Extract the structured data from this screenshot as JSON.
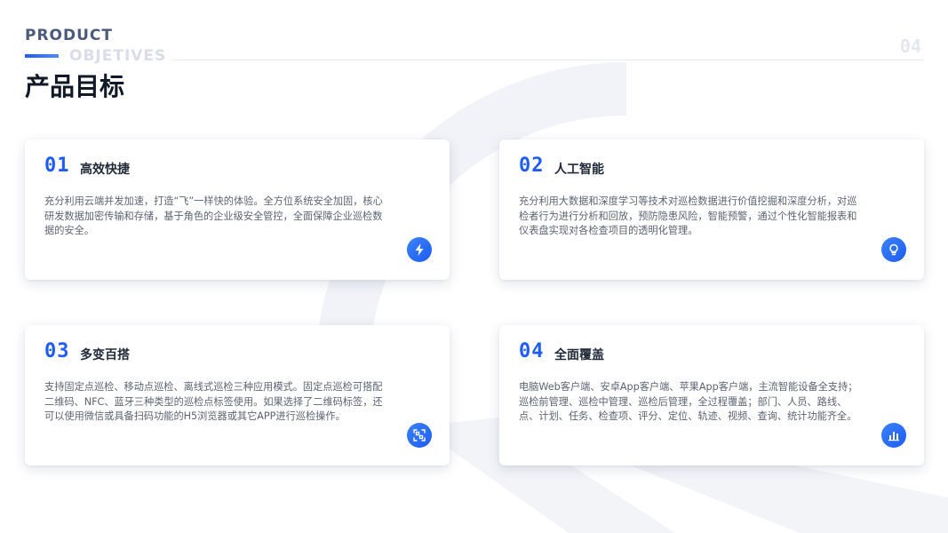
{
  "header": {
    "title_en_1": "PRODUCT",
    "title_en_2": "OBJETIVES",
    "title_cn": "产品目标",
    "page_number": "04"
  },
  "cards": [
    {
      "number": "01",
      "title": "高效快捷",
      "description": "充分利用云端并发加速，打造“飞”一样快的体验。全方位系统安全加固，核心研发数据加密传输和存储，基于角色的企业级安全管控，全面保障企业巡检数据的安全。",
      "icon": "lightning-icon"
    },
    {
      "number": "02",
      "title": "人工智能",
      "description": "充分利用大数据和深度学习等技术对巡检数据进行价值挖掘和深度分析，对巡检者行为进行分析和回放，预防隐患风险，智能预警，通过个性化智能报表和仪表盘实现对各检查项目的透明化管理。",
      "icon": "lightbulb-icon"
    },
    {
      "number": "03",
      "title": "多变百搭",
      "description": "支持固定点巡检、移动点巡检、离线式巡检三种应用模式。固定点巡检可搭配二维码、NFC、蓝牙三种类型的巡检点标签使用。如果选择了二维码标签，还可以使用微信或具备扫码功能的H5浏览器或其它APP进行巡检操作。",
      "icon": "scan-icon"
    },
    {
      "number": "04",
      "title": "全面覆盖",
      "description": "电脑Web客户端、安卓App客户端、苹果App客户端，主流智能设备全支持；巡检前管理、巡检中管理、巡检后管理，全过程覆盖；部门、人员、路线、点、计划、任务、检查项、评分、定位、轨迹、视频、查询、统计功能齐全。",
      "icon": "bar-chart-icon"
    }
  ],
  "colors": {
    "accent": "#1d5cf5",
    "title_dark": "#111827",
    "header_gray": "#4a5a7a",
    "header_light": "#d8dde8"
  }
}
